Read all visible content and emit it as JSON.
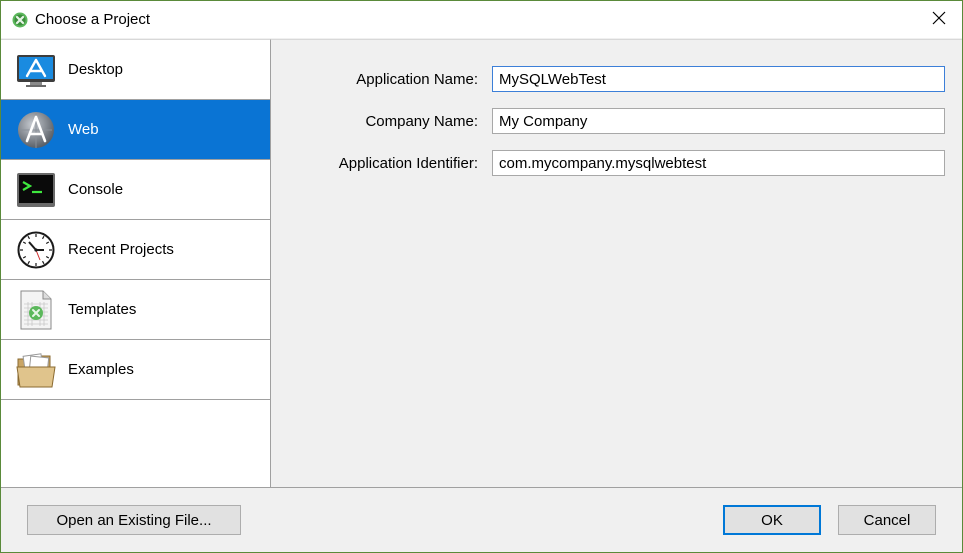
{
  "window": {
    "title": "Choose a Project"
  },
  "sidebar": {
    "items": [
      {
        "label": "Desktop",
        "icon": "desktop-icon"
      },
      {
        "label": "Web",
        "icon": "web-icon"
      },
      {
        "label": "Console",
        "icon": "console-icon"
      },
      {
        "label": "Recent Projects",
        "icon": "clock-icon"
      },
      {
        "label": "Templates",
        "icon": "template-icon"
      },
      {
        "label": "Examples",
        "icon": "folder-icon"
      }
    ],
    "selected": "Web"
  },
  "form": {
    "app_name_label": "Application Name:",
    "app_name_value": "MySQLWebTest",
    "company_label": "Company Name:",
    "company_value": "My Company",
    "identifier_label": "Application Identifier:",
    "identifier_value": "com.mycompany.mysqlwebtest"
  },
  "footer": {
    "open_label": "Open an Existing File...",
    "ok_label": "OK",
    "cancel_label": "Cancel"
  },
  "colors": {
    "selection": "#0a74d4",
    "window_bg": "#f0f0f0",
    "accent_green": "#4caf50"
  }
}
